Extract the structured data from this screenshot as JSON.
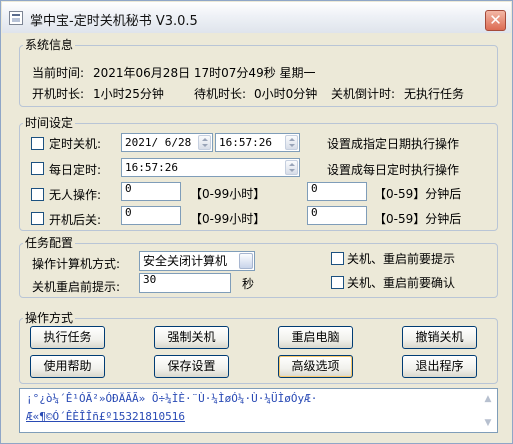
{
  "window": {
    "title": "掌中宝-定时关机秘书 V3.0.5",
    "close_label": "✕"
  },
  "system_info": {
    "legend": "系统信息",
    "current_time_label": "当前时间:",
    "current_time": "2021年06月28日 17时07分49秒 星期一",
    "uptime_label": "开机时长:",
    "uptime": "1小时25分钟",
    "idle_label": "待机时长:",
    "idle": "0小时0分钟",
    "countdown_label": "关机倒计时:",
    "countdown": "无执行任务"
  },
  "time_settings": {
    "legend": "时间设定",
    "scheduled_shutdown": {
      "label": "定时关机:",
      "date": "2021/ 6/28",
      "time": "16:57:26",
      "hint": "设置成指定日期执行操作",
      "checked": false
    },
    "daily": {
      "label": "每日定时:",
      "time": "16:57:26",
      "hint": "设置成每日定时执行操作",
      "checked": false
    },
    "idle_action": {
      "label": "无人操作:",
      "hours": "0",
      "hours_range": "【0-99小时】",
      "minutes": "0",
      "minutes_range": "【0-59】分钟后",
      "checked": false
    },
    "after_boot": {
      "label": "开机后关:",
      "hours": "0",
      "hours_range": "【0-99小时】",
      "minutes": "0",
      "minutes_range": "【0-59】分钟后",
      "checked": false
    }
  },
  "task_config": {
    "legend": "任务配置",
    "mode_label": "操作计算机方式:",
    "mode_value": "安全关闭计算机",
    "reminder_label": "关机重启前提示:",
    "reminder_value": "30",
    "reminder_unit": "秒",
    "prompt_option": {
      "label": "关机、重启前要提示",
      "checked": false
    },
    "confirm_option": {
      "label": "关机、重启前要确认",
      "checked": false
    }
  },
  "actions": {
    "legend": "操作方式",
    "execute": "执行任务",
    "force_shutdown": "强制关机",
    "restart": "重启电脑",
    "cancel_shutdown": "撤销关机",
    "help": "使用帮助",
    "save": "保存设置",
    "advanced": "高级选项",
    "exit": "退出程序"
  },
  "log": {
    "line1": "¡°¿ò¼´Ê¹ÓÃ²»ÓÐÄÃÃ» Ö÷¼ÌÈ·¨Ù·¼ÌøÓ¼·Ù·¼ÜÌøÓyÆ·",
    "line2": "Æ«¶©Ó´ÊÈÎÎñ£º15321810516"
  },
  "icons": {
    "app": "app-icon",
    "close": "close-icon",
    "spinner": "spin-icon",
    "dropdown": "dropdown-icon"
  }
}
